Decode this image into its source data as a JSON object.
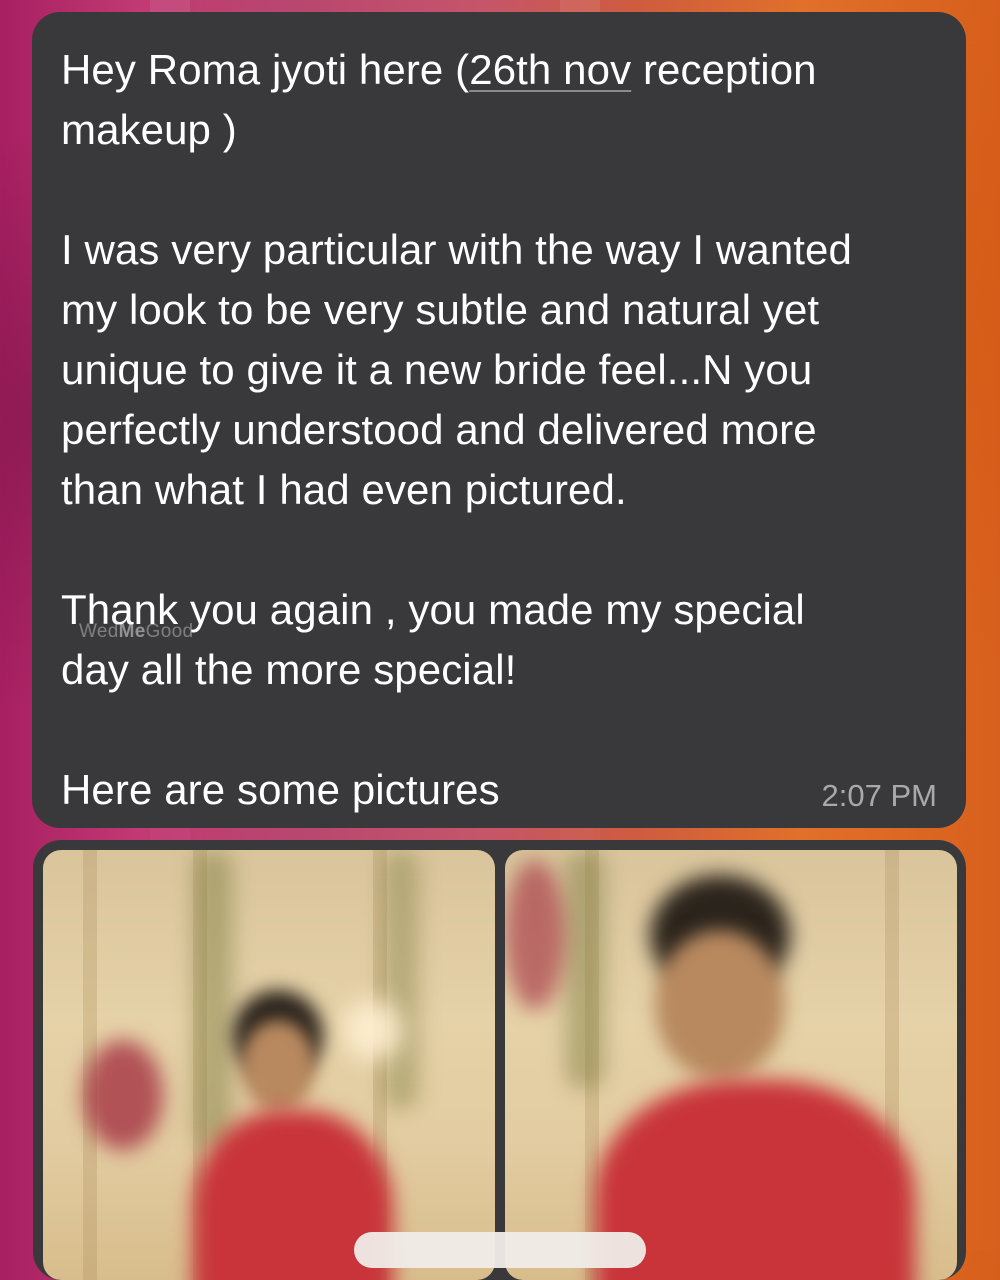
{
  "message": {
    "line_1_before": "Hey Roma jyoti here (",
    "date_link": "26th nov",
    "line_1_after": " reception\nmakeup )",
    "paragraph_2": "I was very particular with the way I wanted\nmy look to be very subtle and natural yet\nunique to give it a new bride feel...N you\nperfectly understood and delivered more\nthan what I had even pictured.",
    "paragraph_3": "Thank you again , you made my special\nday all the more special!",
    "paragraph_4": "Here are some pictures",
    "timestamp": "2:07 PM"
  },
  "watermark": {
    "prefix": "Wed",
    "brand": "Me",
    "suffix": "Good"
  },
  "attachments": {
    "photos": [
      {
        "subject": "bride-full-portrait"
      },
      {
        "subject": "bride-closeup-portrait"
      }
    ]
  },
  "colors": {
    "bubble": "#39393b",
    "text": "#ffffff",
    "timestamp": "#a9a9ac",
    "saree": "#c8343a"
  }
}
